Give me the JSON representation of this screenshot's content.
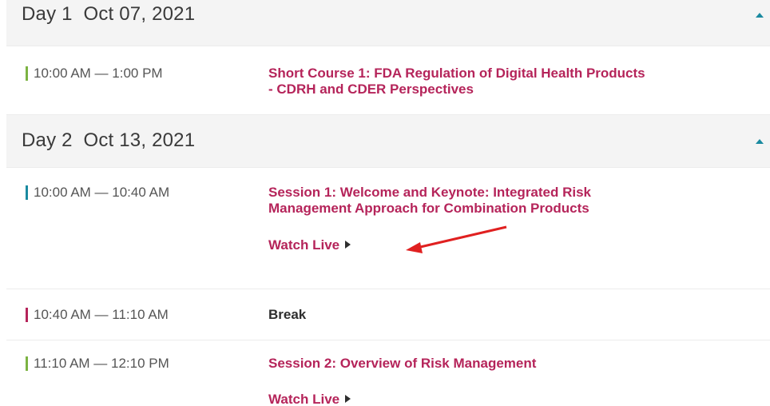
{
  "days": [
    {
      "label": "Day 1",
      "date": "Oct 07, 2021"
    },
    {
      "label": "Day 2",
      "date": "Oct 13, 2021"
    }
  ],
  "sessions": [
    {
      "time": "10:00 AM — 1:00 PM",
      "title_line1": "Short Course 1: FDA Regulation of Digital Health Products",
      "title_line2": "- CDRH and CDER Perspectives",
      "bar_color": "#7cb342"
    },
    {
      "time": "10:00 AM — 10:40 AM",
      "title_line1": "Session 1: Welcome and Keynote: Integrated Risk",
      "title_line2": "Management Approach for Combination Products",
      "watch_label": "Watch Live",
      "bar_color": "#1a8aa0"
    },
    {
      "time": "10:40 AM — 11:10 AM",
      "title": "Break",
      "bar_color": "#b5245a"
    },
    {
      "time": "11:10 AM — 12:10 PM",
      "title": "Session 2: Overview of Risk Management",
      "watch_label": "Watch Live",
      "bar_color": "#7cb342"
    }
  ],
  "colors": {
    "accent": "#b5245a",
    "caret": "#1a8aa0",
    "annotation_arrow": "#e02020"
  }
}
